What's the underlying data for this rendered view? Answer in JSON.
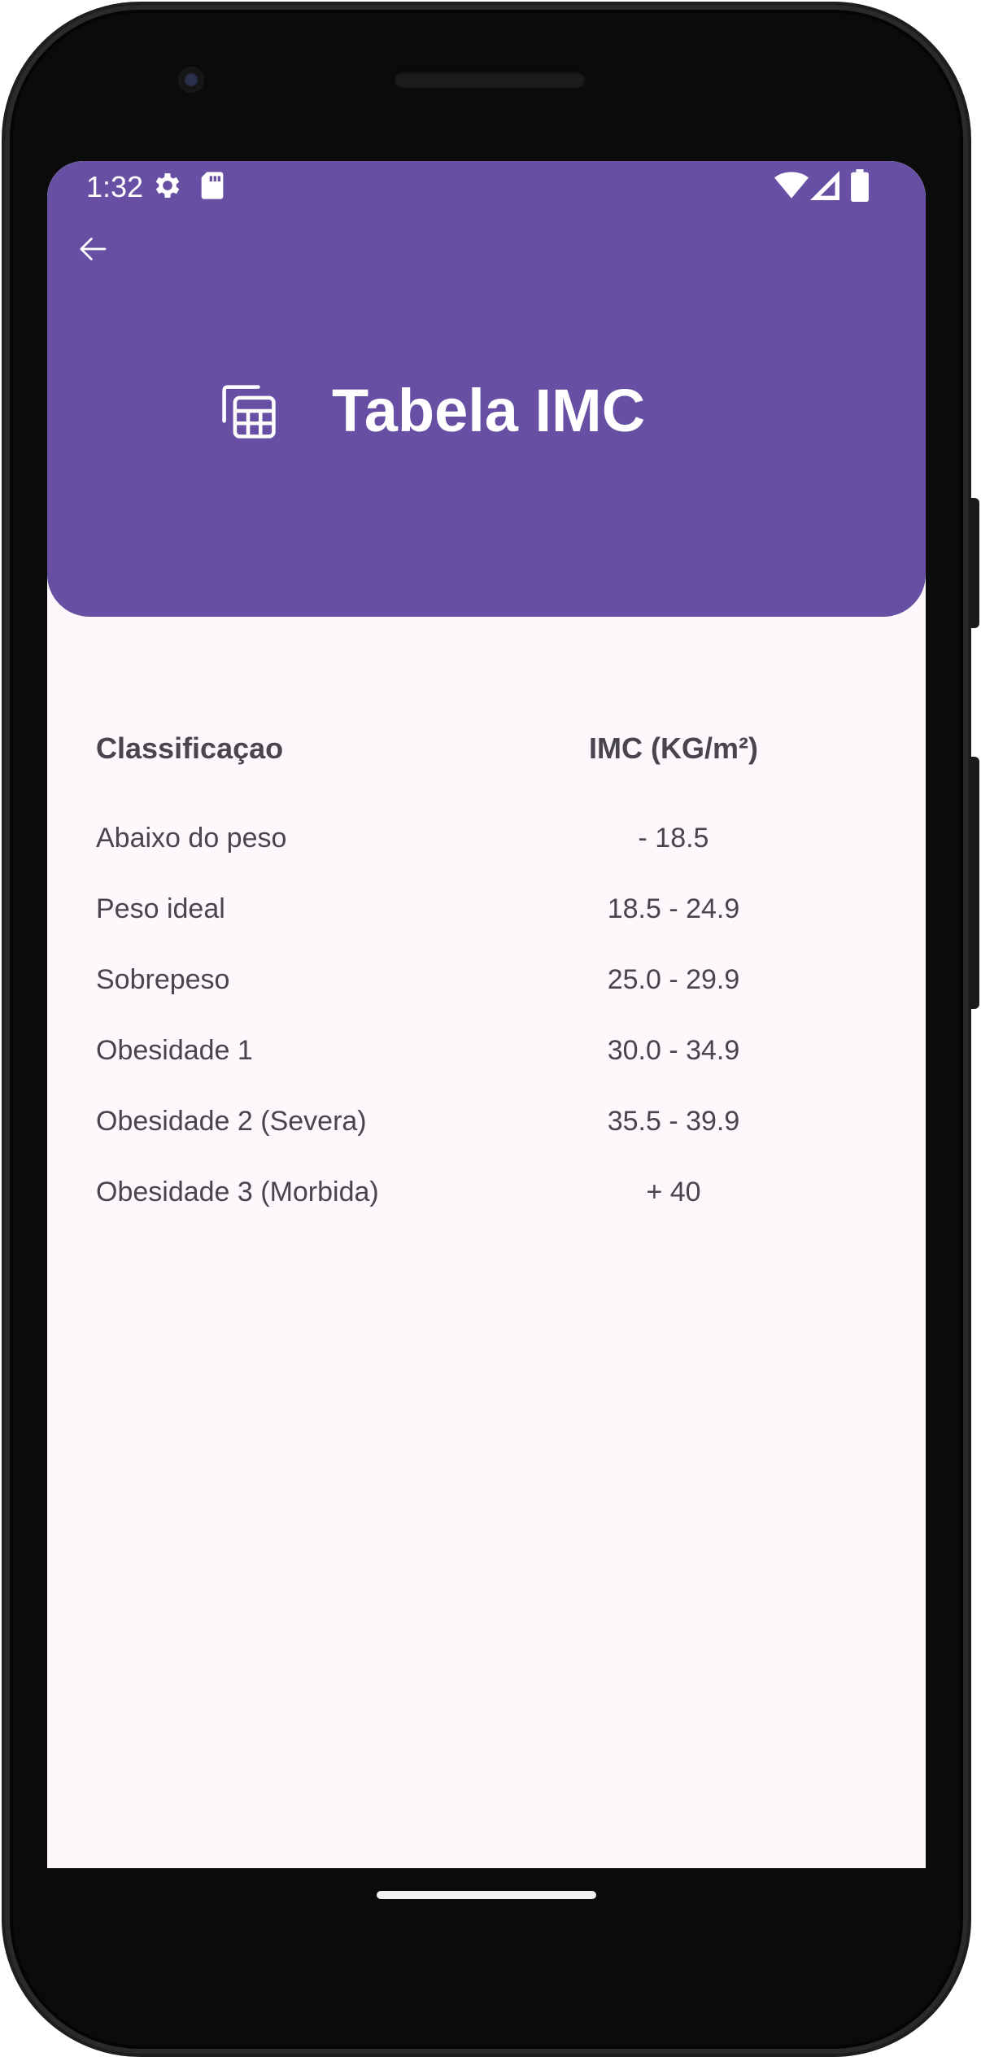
{
  "status_bar": {
    "time": "1:32",
    "icons_left": [
      "settings-icon",
      "sd-card-icon"
    ],
    "icons_right": [
      "wifi-icon",
      "cell-signal-icon",
      "battery-icon"
    ]
  },
  "header": {
    "back_icon": "arrow-left-icon",
    "title_icon": "table-icon",
    "title": "Tabela IMC",
    "color": "#6750a4"
  },
  "table": {
    "columns": [
      "Classificaçao",
      "IMC (KG/m²)"
    ],
    "rows": [
      {
        "classification": "Abaixo do peso",
        "imc": "- 18.5"
      },
      {
        "classification": "Peso ideal",
        "imc": "18.5 - 24.9"
      },
      {
        "classification": "Sobrepeso",
        "imc": "25.0 - 29.9"
      },
      {
        "classification": "Obesidade 1",
        "imc": "30.0 - 34.9"
      },
      {
        "classification": "Obesidade 2 (Severa)",
        "imc": "35.5 - 39.9"
      },
      {
        "classification": "Obesidade 3 (Morbida)",
        "imc": "+ 40"
      }
    ]
  },
  "colors": {
    "accent": "#6750a4",
    "background": "#fdf8fc",
    "text": "#48454e"
  }
}
